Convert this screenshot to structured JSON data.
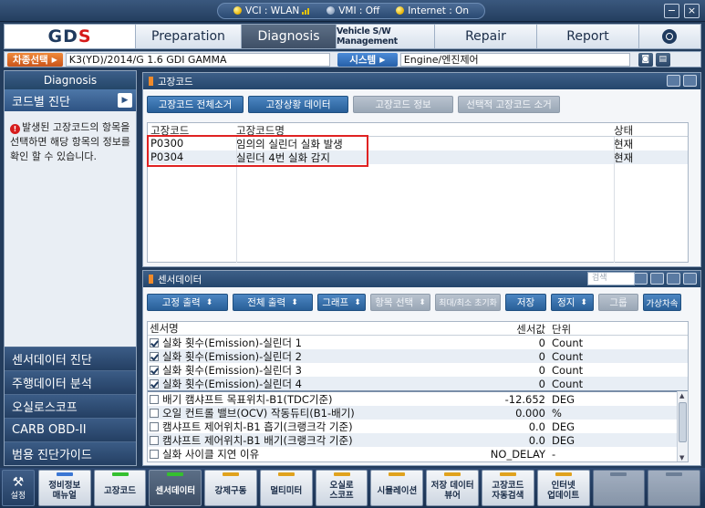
{
  "titlebar": {
    "vci": "VCI : WLAN",
    "vmi": "VMI : Off",
    "internet": "Internet : On",
    "minimize_glyph": "−",
    "close_glyph": "×"
  },
  "nav": {
    "logo_main": "GD",
    "logo_accent": "S",
    "tabs": [
      "Preparation",
      "Diagnosis",
      "Vehicle S/W Management",
      "Repair",
      "Report"
    ],
    "active_tab": "Diagnosis"
  },
  "vehicle": {
    "select_label": "차종선택",
    "model": "K3(YD)/2014/G 1.6 GDI GAMMA",
    "system_label": "시스템",
    "system": "Engine/엔진제어"
  },
  "left": {
    "header": "Diagnosis",
    "active_item": "코드별 진단",
    "info": "발생된 고장코드의 항목을 선택하면 해당 항목의 정보를 확인 할 수 있습니다.",
    "menu": [
      "센서데이터 진단",
      "주행데이터 분석",
      "오실로스코프",
      "CARB OBD-II",
      "범용 진단가이드"
    ]
  },
  "dtc": {
    "title": "고장코드",
    "buttons": [
      "고장코드 전체소거",
      "고장상황 데이터",
      "고장코드 정보",
      "선택적 고장코드 소거"
    ],
    "columns": [
      "고장코드",
      "고장코드명",
      "상태"
    ],
    "rows": [
      {
        "code": "P0300",
        "name": "임의의 실린더 실화 발생",
        "state": "현재"
      },
      {
        "code": "P0304",
        "name": "실린더 4번 실화 감지",
        "state": "현재"
      }
    ]
  },
  "sensor": {
    "title": "센서데이터",
    "search_placeholder": "검색",
    "buttons": [
      "고정 출력",
      "전체 출력",
      "그래프",
      "항목 선택",
      "최대/최소 초기화",
      "저장",
      "정지",
      "그룹",
      "가상차속"
    ],
    "columns": [
      "센서명",
      "센서값",
      "단위"
    ],
    "rows": [
      {
        "name": "실화 횟수(Emission)-실린더 1",
        "value": "0",
        "unit": "Count",
        "checked": true
      },
      {
        "name": "실화 횟수(Emission)-실린더 2",
        "value": "0",
        "unit": "Count",
        "checked": true
      },
      {
        "name": "실화 횟수(Emission)-실린더 3",
        "value": "0",
        "unit": "Count",
        "checked": true
      },
      {
        "name": "실화 횟수(Emission)-실린더 4",
        "value": "0",
        "unit": "Count",
        "checked": true
      },
      {
        "name": "배기 캠샤프트 목표위치-B1(TDC기준)",
        "value": "-12.652",
        "unit": "DEG",
        "checked": false
      },
      {
        "name": "오일 컨트롤 밸브(OCV) 작동듀티(B1-배기)",
        "value": "0.000",
        "unit": "%",
        "checked": false
      },
      {
        "name": "캠샤프트 제어위치-B1 흡기(크랭크각 기준)",
        "value": "0.0",
        "unit": "DEG",
        "checked": false
      },
      {
        "name": "캠샤프트 제어위치-B1 배기(크랭크각 기준)",
        "value": "0.0",
        "unit": "DEG",
        "checked": false
      },
      {
        "name": "실화 사이클 지연 이유",
        "value": "NO_DELAY",
        "unit": "-",
        "checked": false
      }
    ]
  },
  "bottom": {
    "settings": "설정",
    "buttons": [
      {
        "line1": "정비정보",
        "line2": "매뉴얼",
        "led": "blue"
      },
      {
        "line1": "고장코드",
        "line2": "",
        "led": "green"
      },
      {
        "line1": "센서데이터",
        "line2": "",
        "led": "green",
        "active": true
      },
      {
        "line1": "강제구동",
        "line2": "",
        "led": "orange"
      },
      {
        "line1": "멀티미터",
        "line2": "",
        "led": "orange"
      },
      {
        "line1": "오실로",
        "line2": "스코프",
        "led": "orange"
      },
      {
        "line1": "시뮬레이션",
        "line2": "",
        "led": "orange"
      },
      {
        "line1": "저장 데이터",
        "line2": "뷰어",
        "led": "orange"
      },
      {
        "line1": "고장코드",
        "line2": "자동검색",
        "led": "orange"
      },
      {
        "line1": "인터넷",
        "line2": "업데이트",
        "led": "orange"
      },
      {
        "line1": "",
        "line2": "",
        "led": "off"
      },
      {
        "line1": "",
        "line2": "",
        "led": "off"
      }
    ]
  },
  "colors": {
    "accent": "#2c5f98",
    "highlight": "#e02222",
    "tab_orange": "#f08a3a"
  }
}
